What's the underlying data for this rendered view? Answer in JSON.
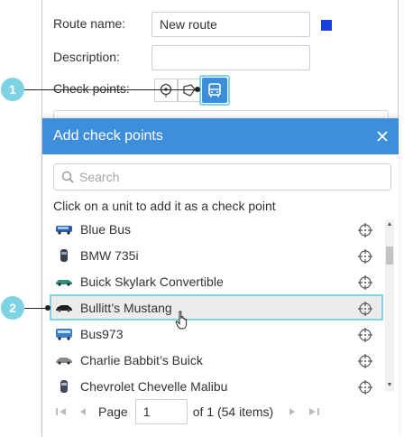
{
  "route_form": {
    "name_label": "Route name:",
    "name_value": "New route",
    "description_label": "Description:",
    "description_value": "",
    "checkpoints_label": "Check points:",
    "route_color": "#1a3fd6"
  },
  "callouts": {
    "first": "1",
    "second": "2"
  },
  "dialog": {
    "title": "Add check points",
    "search_placeholder": "Search",
    "hint": "Click on a unit to add it as a check point",
    "units": [
      {
        "name": "Blue Bus",
        "icon": "bus-icon"
      },
      {
        "name": "BMW 735i",
        "icon": "car-top-icon"
      },
      {
        "name": "Buick Skylark Convertible",
        "icon": "convertible-icon"
      },
      {
        "name": "Bullitt’s Mustang",
        "icon": "sports-car-icon"
      },
      {
        "name": "Bus973",
        "icon": "bus-icon"
      },
      {
        "name": "Charlie Babbit’s Buick",
        "icon": "sedan-icon"
      },
      {
        "name": "Chevrolet Chevelle Malibu",
        "icon": "car-top-icon"
      }
    ],
    "pager": {
      "page_label": "Page",
      "page_value": "1",
      "of_text": "of 1 (54 items)"
    }
  },
  "colors": {
    "accent": "#3d8fdc",
    "highlight": "#7fd4e6",
    "callout": "#7dd3e3"
  }
}
